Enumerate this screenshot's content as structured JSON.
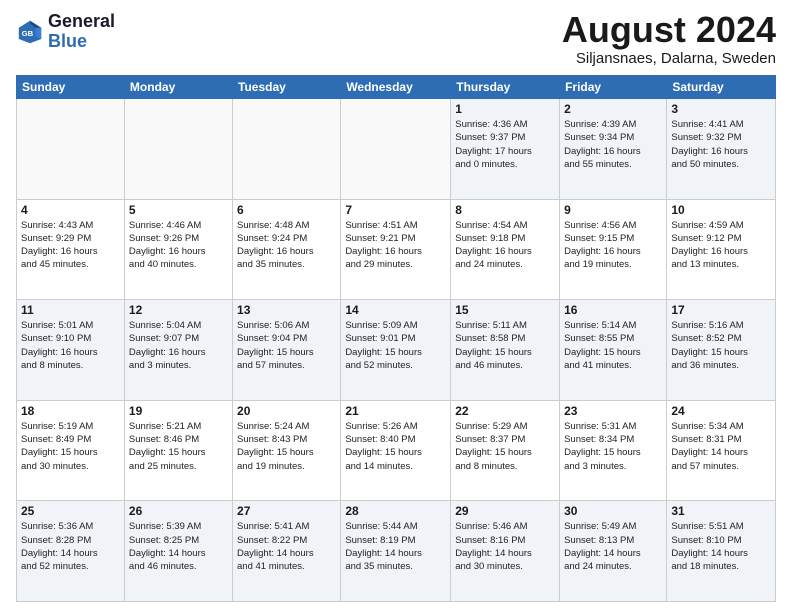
{
  "logo": {
    "line1": "General",
    "line2": "Blue"
  },
  "title": "August 2024",
  "subtitle": "Siljansnaes, Dalarna, Sweden",
  "days_of_week": [
    "Sunday",
    "Monday",
    "Tuesday",
    "Wednesday",
    "Thursday",
    "Friday",
    "Saturday"
  ],
  "weeks": [
    [
      {
        "day": "",
        "info": ""
      },
      {
        "day": "",
        "info": ""
      },
      {
        "day": "",
        "info": ""
      },
      {
        "day": "",
        "info": ""
      },
      {
        "day": "1",
        "info": "Sunrise: 4:36 AM\nSunset: 9:37 PM\nDaylight: 17 hours\nand 0 minutes."
      },
      {
        "day": "2",
        "info": "Sunrise: 4:39 AM\nSunset: 9:34 PM\nDaylight: 16 hours\nand 55 minutes."
      },
      {
        "day": "3",
        "info": "Sunrise: 4:41 AM\nSunset: 9:32 PM\nDaylight: 16 hours\nand 50 minutes."
      }
    ],
    [
      {
        "day": "4",
        "info": "Sunrise: 4:43 AM\nSunset: 9:29 PM\nDaylight: 16 hours\nand 45 minutes."
      },
      {
        "day": "5",
        "info": "Sunrise: 4:46 AM\nSunset: 9:26 PM\nDaylight: 16 hours\nand 40 minutes."
      },
      {
        "day": "6",
        "info": "Sunrise: 4:48 AM\nSunset: 9:24 PM\nDaylight: 16 hours\nand 35 minutes."
      },
      {
        "day": "7",
        "info": "Sunrise: 4:51 AM\nSunset: 9:21 PM\nDaylight: 16 hours\nand 29 minutes."
      },
      {
        "day": "8",
        "info": "Sunrise: 4:54 AM\nSunset: 9:18 PM\nDaylight: 16 hours\nand 24 minutes."
      },
      {
        "day": "9",
        "info": "Sunrise: 4:56 AM\nSunset: 9:15 PM\nDaylight: 16 hours\nand 19 minutes."
      },
      {
        "day": "10",
        "info": "Sunrise: 4:59 AM\nSunset: 9:12 PM\nDaylight: 16 hours\nand 13 minutes."
      }
    ],
    [
      {
        "day": "11",
        "info": "Sunrise: 5:01 AM\nSunset: 9:10 PM\nDaylight: 16 hours\nand 8 minutes."
      },
      {
        "day": "12",
        "info": "Sunrise: 5:04 AM\nSunset: 9:07 PM\nDaylight: 16 hours\nand 3 minutes."
      },
      {
        "day": "13",
        "info": "Sunrise: 5:06 AM\nSunset: 9:04 PM\nDaylight: 15 hours\nand 57 minutes."
      },
      {
        "day": "14",
        "info": "Sunrise: 5:09 AM\nSunset: 9:01 PM\nDaylight: 15 hours\nand 52 minutes."
      },
      {
        "day": "15",
        "info": "Sunrise: 5:11 AM\nSunset: 8:58 PM\nDaylight: 15 hours\nand 46 minutes."
      },
      {
        "day": "16",
        "info": "Sunrise: 5:14 AM\nSunset: 8:55 PM\nDaylight: 15 hours\nand 41 minutes."
      },
      {
        "day": "17",
        "info": "Sunrise: 5:16 AM\nSunset: 8:52 PM\nDaylight: 15 hours\nand 36 minutes."
      }
    ],
    [
      {
        "day": "18",
        "info": "Sunrise: 5:19 AM\nSunset: 8:49 PM\nDaylight: 15 hours\nand 30 minutes."
      },
      {
        "day": "19",
        "info": "Sunrise: 5:21 AM\nSunset: 8:46 PM\nDaylight: 15 hours\nand 25 minutes."
      },
      {
        "day": "20",
        "info": "Sunrise: 5:24 AM\nSunset: 8:43 PM\nDaylight: 15 hours\nand 19 minutes."
      },
      {
        "day": "21",
        "info": "Sunrise: 5:26 AM\nSunset: 8:40 PM\nDaylight: 15 hours\nand 14 minutes."
      },
      {
        "day": "22",
        "info": "Sunrise: 5:29 AM\nSunset: 8:37 PM\nDaylight: 15 hours\nand 8 minutes."
      },
      {
        "day": "23",
        "info": "Sunrise: 5:31 AM\nSunset: 8:34 PM\nDaylight: 15 hours\nand 3 minutes."
      },
      {
        "day": "24",
        "info": "Sunrise: 5:34 AM\nSunset: 8:31 PM\nDaylight: 14 hours\nand 57 minutes."
      }
    ],
    [
      {
        "day": "25",
        "info": "Sunrise: 5:36 AM\nSunset: 8:28 PM\nDaylight: 14 hours\nand 52 minutes."
      },
      {
        "day": "26",
        "info": "Sunrise: 5:39 AM\nSunset: 8:25 PM\nDaylight: 14 hours\nand 46 minutes."
      },
      {
        "day": "27",
        "info": "Sunrise: 5:41 AM\nSunset: 8:22 PM\nDaylight: 14 hours\nand 41 minutes."
      },
      {
        "day": "28",
        "info": "Sunrise: 5:44 AM\nSunset: 8:19 PM\nDaylight: 14 hours\nand 35 minutes."
      },
      {
        "day": "29",
        "info": "Sunrise: 5:46 AM\nSunset: 8:16 PM\nDaylight: 14 hours\nand 30 minutes."
      },
      {
        "day": "30",
        "info": "Sunrise: 5:49 AM\nSunset: 8:13 PM\nDaylight: 14 hours\nand 24 minutes."
      },
      {
        "day": "31",
        "info": "Sunrise: 5:51 AM\nSunset: 8:10 PM\nDaylight: 14 hours\nand 18 minutes."
      }
    ]
  ]
}
